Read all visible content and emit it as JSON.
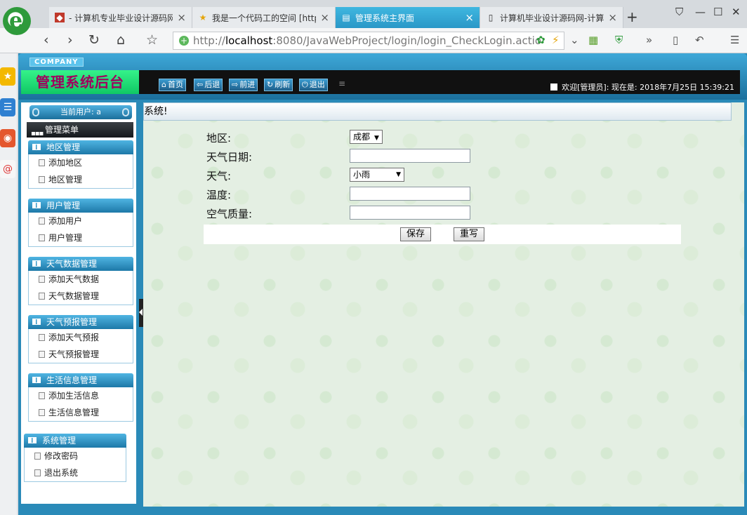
{
  "browser": {
    "logo_letter": "e",
    "tabs": [
      {
        "title": "- 计算机专业毕业设计源码网",
        "icon": "red-page-icon",
        "active": false
      },
      {
        "title": "我是一个代码工的空间 [http://",
        "icon": "star-page-icon",
        "active": false
      },
      {
        "title": "管理系统主界面",
        "icon": "document-icon",
        "active": true
      },
      {
        "title": "计算机毕业设计源码网-计算",
        "icon": "document-icon",
        "active": false
      }
    ],
    "url_scheme": "http://",
    "url_host": "localhost",
    "url_rest": ":8080/JavaWebProject/login/login_CheckLogin.actio"
  },
  "app": {
    "company": "COMPANY",
    "system_title": "管理系统后台",
    "nav": [
      {
        "label": "首页",
        "icon": "home-icon",
        "glyph": "⌂"
      },
      {
        "label": "后退",
        "icon": "back-arrow-icon",
        "glyph": "⇦"
      },
      {
        "label": "前进",
        "icon": "forward-arrow-icon",
        "glyph": "⇨"
      },
      {
        "label": "刷新",
        "icon": "refresh-icon",
        "glyph": "↻"
      },
      {
        "label": "退出",
        "icon": "power-icon",
        "glyph": "⏻"
      }
    ],
    "welcome": "欢迎[管理员]:  现在是: 2018年7月25日 15:39:21",
    "current_user": "当前用户: a",
    "menu_title": "管理菜单",
    "groups": [
      {
        "title": "地区管理",
        "items": [
          "添加地区",
          "地区管理"
        ]
      },
      {
        "title": "用户管理",
        "items": [
          "添加用户",
          "用户管理"
        ]
      },
      {
        "title": "天气数据管理",
        "items": [
          "添加天气数据",
          "天气数据管理"
        ]
      },
      {
        "title": "天气预报管理",
        "items": [
          "添加天气预报",
          "天气预报管理"
        ]
      },
      {
        "title": "生活信息管理",
        "items": [
          "添加生活信息",
          "生活信息管理"
        ]
      },
      {
        "title": "系统管理",
        "items": [
          "修改密码",
          "退出系统"
        ]
      }
    ],
    "main_title": "系统!",
    "form": {
      "region_label": "地区:",
      "region_value": "成都",
      "date_label": "天气日期:",
      "date_value": "",
      "weather_label": "天气:",
      "weather_value": "小雨",
      "temp_label": "温度:",
      "temp_value": "",
      "air_label": "空气质量:",
      "air_value": "",
      "save": "保存",
      "reset": "重写"
    }
  },
  "colors": {
    "accent": "#2a8ab8",
    "title_green": "#10c864",
    "title_text": "#a0005e"
  }
}
